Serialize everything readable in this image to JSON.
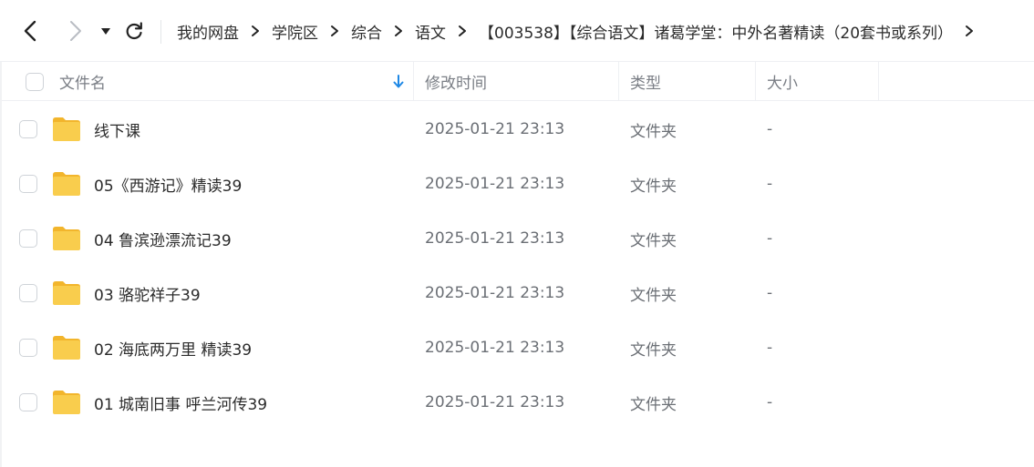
{
  "toolbar": {
    "back_icon": "chevron-left-icon",
    "forward_icon": "chevron-right-icon",
    "dropdown_icon": "caret-down-icon",
    "refresh_icon": "refresh-icon"
  },
  "breadcrumb": [
    "我的网盘",
    "学院区",
    "综合",
    "语文",
    "【003538】【综合语文】诸葛学堂：中外名著精读（20套书或系列）"
  ],
  "columns": {
    "name": "文件名",
    "modified": "修改时间",
    "type": "类型",
    "size": "大小"
  },
  "sort_icon": "arrow-down-icon",
  "files": [
    {
      "name": "线下课",
      "modified": "2025-01-21 23:13",
      "type": "文件夹",
      "size": "-"
    },
    {
      "name": "05《西游记》精读39",
      "modified": "2025-01-21 23:13",
      "type": "文件夹",
      "size": "-"
    },
    {
      "name": "04 鲁滨逊漂流记39",
      "modified": "2025-01-21 23:13",
      "type": "文件夹",
      "size": "-"
    },
    {
      "name": "03 骆驼祥子39",
      "modified": "2025-01-21 23:13",
      "type": "文件夹",
      "size": "-"
    },
    {
      "name": "02 海底两万里 精读39",
      "modified": "2025-01-21 23:13",
      "type": "文件夹",
      "size": "-"
    },
    {
      "name": "01 城南旧事 呼兰河传39",
      "modified": "2025-01-21 23:13",
      "type": "文件夹",
      "size": "-"
    }
  ],
  "colors": {
    "folder": "#f7c948",
    "folder_back": "#f2b52c",
    "sort_arrow": "#1e88e5"
  }
}
